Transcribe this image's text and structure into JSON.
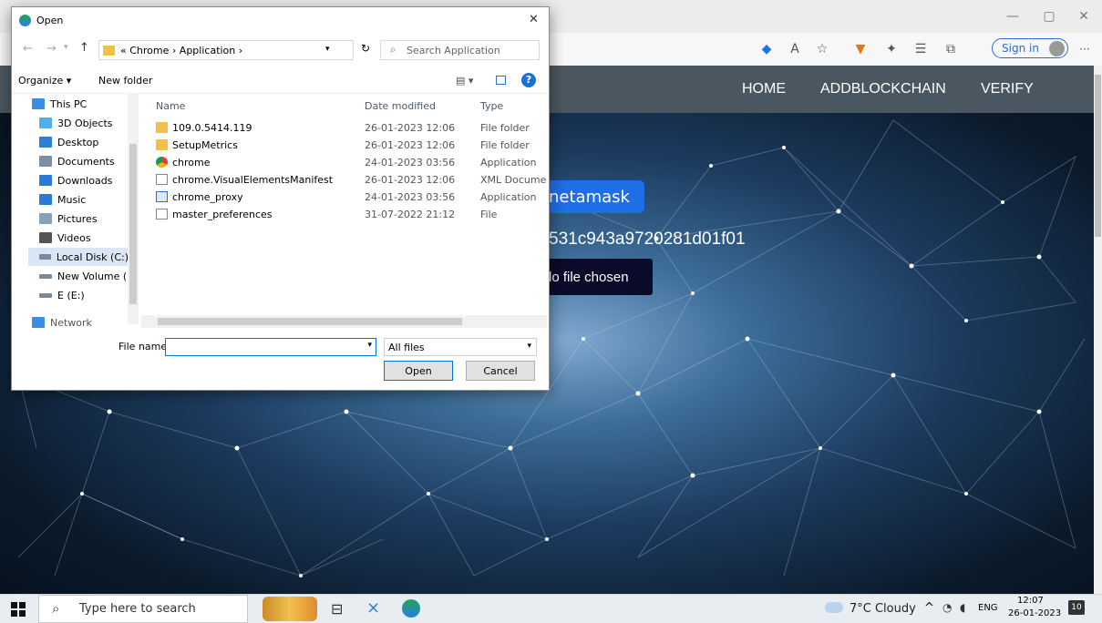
{
  "browser": {
    "signin_label": "Sign in",
    "more_label": "···",
    "win_minimize": "—",
    "win_restore": "▢",
    "win_close": "✕",
    "icons": [
      "shield-icon",
      "read-aloud-icon",
      "favorites-add-icon",
      "metamask-extension-icon",
      "extensions-icon",
      "favorites-icon",
      "collections-icon"
    ]
  },
  "webpage": {
    "nav": [
      "HOME",
      "ADDBLOCKCHAIN",
      "VERIFY"
    ],
    "metamask_label": "netamask",
    "hash_text": "531c943a9720281d01f01",
    "file_chosen_text": "lo file chosen",
    "colors": {
      "navbar": "#4b5760",
      "metamask_button": "#1e6fe6",
      "file_button": "#0a0a2a"
    }
  },
  "dialog": {
    "title": "Open",
    "close_label": "✕",
    "path": {
      "overflow": "«",
      "parts": [
        "Chrome",
        "Application"
      ],
      "sep": "›"
    },
    "search_placeholder": "Search Application",
    "toolbar": {
      "organize": "Organize ▾",
      "new_folder": "New folder",
      "view_icon": "▤ ▾",
      "help": "?"
    },
    "sidebar": [
      {
        "label": "This PC",
        "icon": "this-pc-icon",
        "color": "#3a8ee6"
      },
      {
        "label": "3D Objects",
        "icon": "3d-objects-icon",
        "color": "#4db1e8"
      },
      {
        "label": "Desktop",
        "icon": "desktop-icon",
        "color": "#2b7fd4"
      },
      {
        "label": "Documents",
        "icon": "documents-icon",
        "color": "#7a8ea8"
      },
      {
        "label": "Downloads",
        "icon": "downloads-icon",
        "color": "#2a7ad6"
      },
      {
        "label": "Music",
        "icon": "music-icon",
        "color": "#2a7ad6"
      },
      {
        "label": "Pictures",
        "icon": "pictures-icon",
        "color": "#8aa0b8"
      },
      {
        "label": "Videos",
        "icon": "videos-icon",
        "color": "#555"
      },
      {
        "label": "Local Disk (C:)",
        "icon": "local-disk-icon",
        "color": "#7a8a99"
      },
      {
        "label": "New Volume (D:",
        "icon": "drive-icon",
        "color": "#7a8a99"
      },
      {
        "label": "E (E:)",
        "icon": "drive-icon",
        "color": "#7a8a99"
      },
      {
        "label": "Network",
        "icon": "network-icon",
        "color": "#3a8ee6"
      }
    ],
    "columns": [
      "Name",
      "Date modified",
      "Type"
    ],
    "files": [
      {
        "name": "109.0.5414.119",
        "date": "26-01-2023 12:06",
        "type": "File folder",
        "icon": "folder"
      },
      {
        "name": "SetupMetrics",
        "date": "26-01-2023 12:06",
        "type": "File folder",
        "icon": "folder"
      },
      {
        "name": "chrome",
        "date": "24-01-2023 03:56",
        "type": "Application",
        "icon": "chrome"
      },
      {
        "name": "chrome.VisualElementsManifest",
        "date": "26-01-2023 12:06",
        "type": "XML Document",
        "icon": "xml"
      },
      {
        "name": "chrome_proxy",
        "date": "24-01-2023 03:56",
        "type": "Application",
        "icon": "app"
      },
      {
        "name": "master_preferences",
        "date": "31-07-2022 21:12",
        "type": "File",
        "icon": "file"
      }
    ],
    "filename_label": "File name:",
    "filename_value": "",
    "filter_value": "All files",
    "open_label": "Open",
    "cancel_label": "Cancel"
  },
  "taskbar": {
    "search_placeholder": "Type here to search",
    "weather": "7°C  Cloudy",
    "tray": "^",
    "lang": "ENG",
    "time": "12:07",
    "date": "26-01-2023",
    "notifications": "10"
  }
}
